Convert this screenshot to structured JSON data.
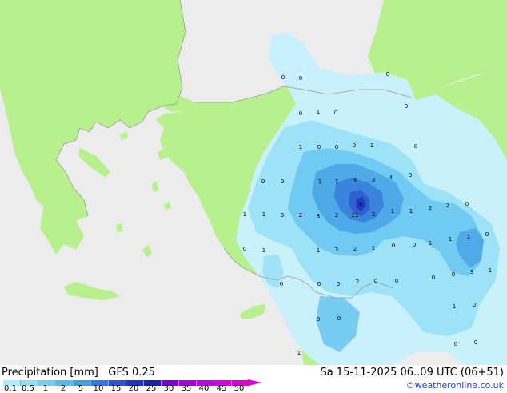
{
  "title": {
    "product": "Precipitation [mm]",
    "model": "GFS 0.25",
    "valid_time": "Sa 15-11-2025 06..09 UTC (06+51)"
  },
  "copyright": "©weatheronline.co.uk",
  "colors": {
    "sea": "#ececec",
    "land": "#b7f08d",
    "coast": "#9a9a9a",
    "precip_levels": [
      "#c8f0ff",
      "#9be0f5",
      "#6ec8f0",
      "#4ba6e6",
      "#3a82dc",
      "#2c5fd2",
      "#1e3cb8",
      "#1428a0"
    ]
  },
  "legend": {
    "scale_colors": [
      "#aaeeff",
      "#8ee0f8",
      "#6fd0f2",
      "#53bcea",
      "#3d9fe0",
      "#2f7ad8",
      "#2657cf",
      "#1d35c2",
      "#1824a6",
      "#7b00d8",
      "#a300e8",
      "#c000f0",
      "#d800e0",
      "#e000c8"
    ],
    "tick_labels": [
      "0.1",
      "0.5",
      "1",
      "2",
      "5",
      "10",
      "15",
      "20",
      "25",
      "30",
      "35",
      "40",
      "45",
      "50"
    ]
  },
  "map_labels": [
    {
      "t": "0"
    },
    {
      "t": "0"
    },
    {
      "t": "0"
    },
    {
      "t": "0"
    },
    {
      "t": "1"
    },
    {
      "t": "0"
    },
    {
      "t": "0"
    },
    {
      "t": "1"
    },
    {
      "t": "0"
    },
    {
      "t": "0"
    },
    {
      "t": "0"
    },
    {
      "t": "1"
    },
    {
      "t": "0"
    },
    {
      "t": "0"
    },
    {
      "t": "0"
    },
    {
      "t": "1"
    },
    {
      "t": "7"
    },
    {
      "t": "6"
    },
    {
      "t": "3"
    },
    {
      "t": "4"
    },
    {
      "t": "0"
    },
    {
      "t": "1"
    },
    {
      "t": "1"
    },
    {
      "t": "3"
    },
    {
      "t": "2"
    },
    {
      "t": "8"
    },
    {
      "t": "2"
    },
    {
      "t": "11"
    },
    {
      "t": "2"
    },
    {
      "t": "1"
    },
    {
      "t": "1"
    },
    {
      "t": "2"
    },
    {
      "t": "2"
    },
    {
      "t": "0"
    },
    {
      "t": "0"
    },
    {
      "t": "1"
    },
    {
      "t": "1"
    },
    {
      "t": "3"
    },
    {
      "t": "2"
    },
    {
      "t": "1"
    },
    {
      "t": "0"
    },
    {
      "t": "0"
    },
    {
      "t": "1"
    },
    {
      "t": "1"
    },
    {
      "t": "1"
    },
    {
      "t": "0"
    },
    {
      "t": "3"
    },
    {
      "t": "1"
    },
    {
      "t": "0"
    },
    {
      "t": "0"
    },
    {
      "t": "0"
    },
    {
      "t": "2"
    },
    {
      "t": "0"
    },
    {
      "t": "0"
    },
    {
      "t": "0"
    },
    {
      "t": "0"
    },
    {
      "t": "1"
    },
    {
      "t": "0"
    },
    {
      "t": "0"
    },
    {
      "t": "0"
    },
    {
      "t": "0"
    },
    {
      "t": "0"
    },
    {
      "t": "1"
    }
  ]
}
